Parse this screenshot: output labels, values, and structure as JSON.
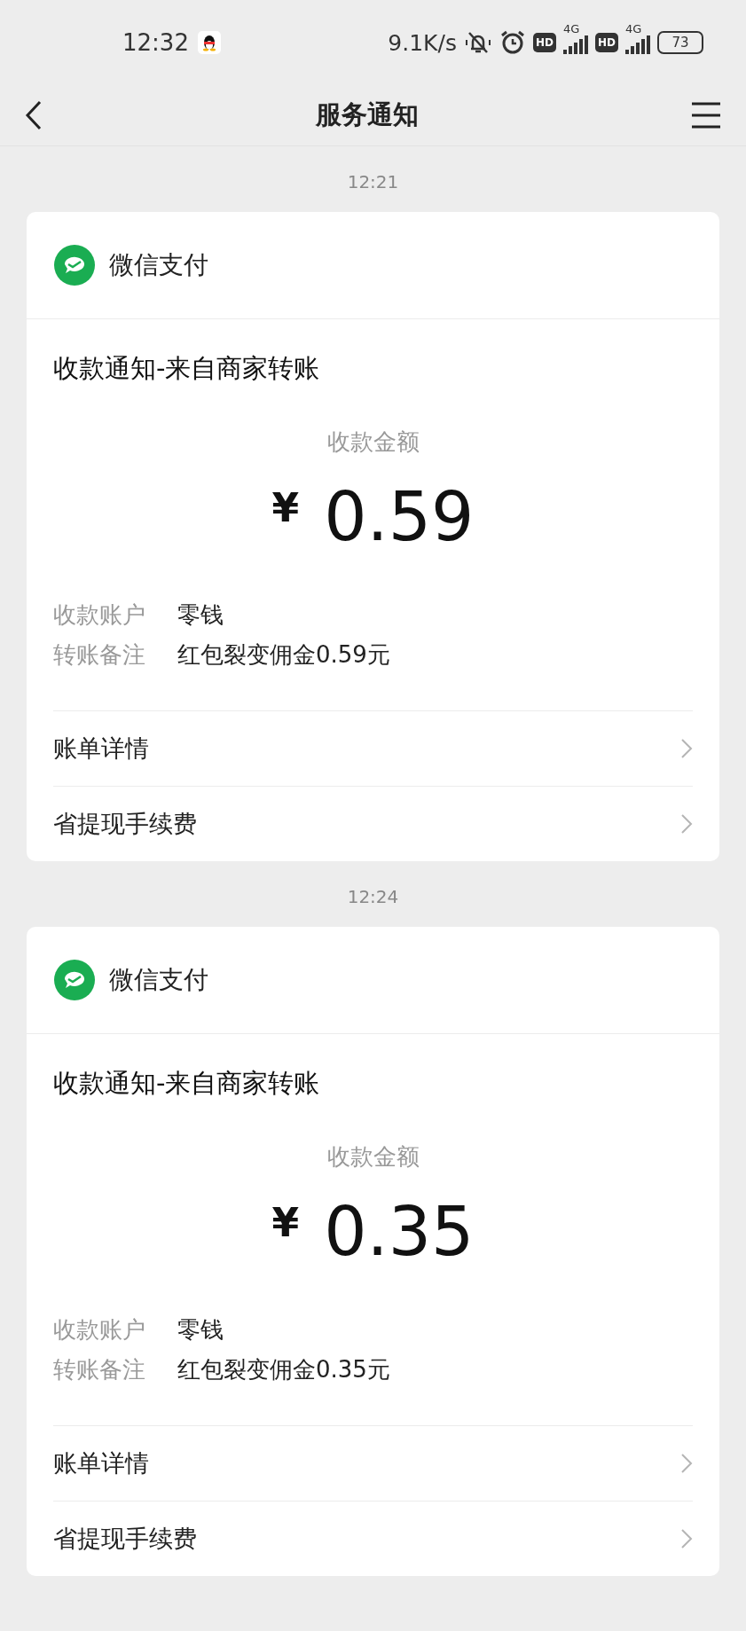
{
  "status_bar": {
    "time": "12:32",
    "speed": "9.1K/s",
    "sim_badges": [
      "HD",
      "HD"
    ],
    "network": [
      "4G",
      "4G"
    ],
    "battery": "73"
  },
  "nav": {
    "title": "服务通知"
  },
  "messages": [
    {
      "time": "12:21",
      "sender": "微信支付",
      "title": "收款通知-来自商家转账",
      "amount_label": "收款金额",
      "currency": "¥",
      "amount": "0.59",
      "fields": [
        {
          "label": "收款账户",
          "value": "零钱"
        },
        {
          "label": "转账备注",
          "value": "红包裂变佣金0.59元"
        }
      ],
      "links": [
        "账单详情",
        "省提现手续费"
      ]
    },
    {
      "time": "12:24",
      "sender": "微信支付",
      "title": "收款通知-来自商家转账",
      "amount_label": "收款金额",
      "currency": "¥",
      "amount": "0.35",
      "fields": [
        {
          "label": "收款账户",
          "value": "零钱"
        },
        {
          "label": "转账备注",
          "value": "红包裂变佣金0.35元"
        }
      ],
      "links": [
        "账单详情",
        "省提现手续费"
      ]
    }
  ]
}
